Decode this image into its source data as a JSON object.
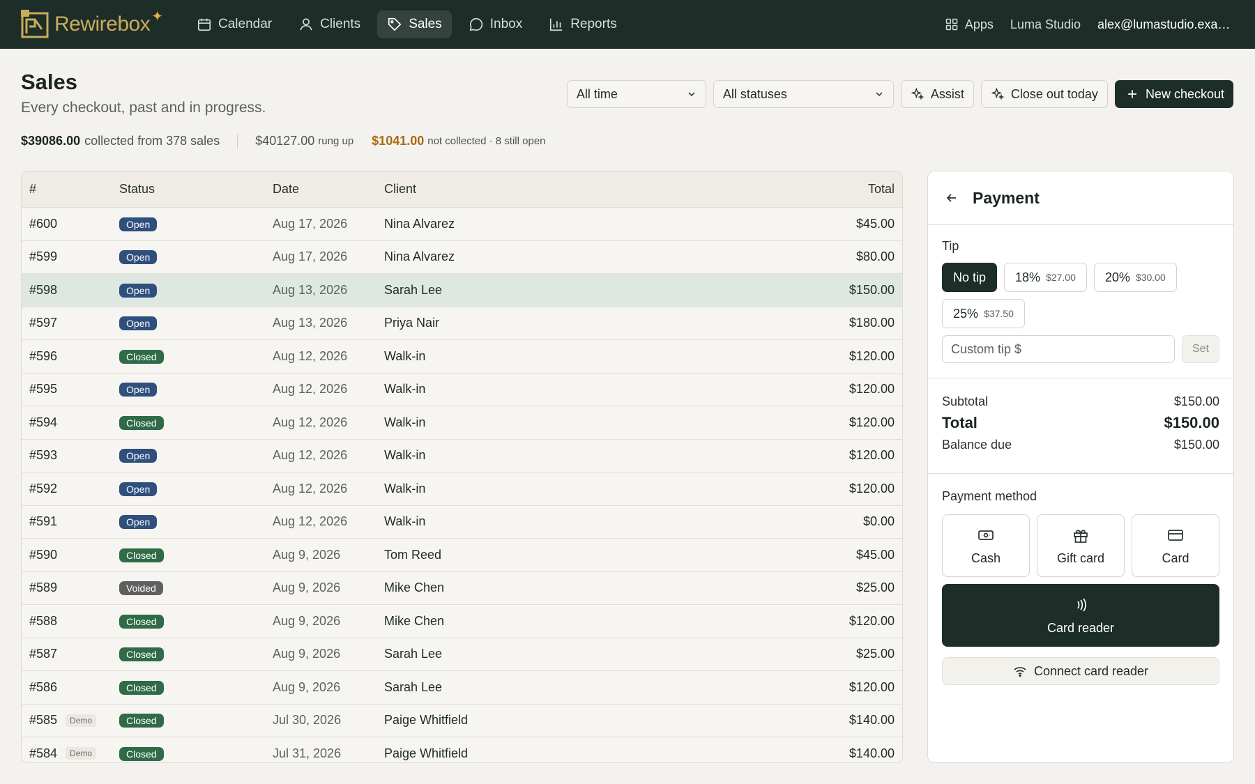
{
  "app": {
    "brand": "Rewirebox",
    "nav": [
      {
        "id": "calendar",
        "label": "Calendar",
        "icon": "calendar-icon"
      },
      {
        "id": "clients",
        "label": "Clients",
        "icon": "user-icon"
      },
      {
        "id": "sales",
        "label": "Sales",
        "icon": "tag-icon",
        "active": true
      },
      {
        "id": "inbox",
        "label": "Inbox",
        "icon": "chat-icon"
      },
      {
        "id": "reports",
        "label": "Reports",
        "icon": "bar-chart-icon"
      }
    ],
    "apps_label": "Apps",
    "workspace": "Luma Studio",
    "user_email": "alex@lumastudio.example.com"
  },
  "header": {
    "title": "Sales",
    "subtitle": "Every checkout, past and in progress.",
    "filters": {
      "time": "All time",
      "status": "All statuses"
    },
    "assist_label": "Assist",
    "close_out_label": "Close out today",
    "new_checkout_label": "New checkout"
  },
  "summary": {
    "collected_amount": "$39086.00",
    "collected_text": "collected from 378 sales",
    "rung_amount": "$40127.00",
    "rung_text": "rung up",
    "not_collected_amount": "$1041.00",
    "not_collected_text": "not collected · 8 still open"
  },
  "table": {
    "columns": [
      "#",
      "Status",
      "Date",
      "Client",
      "Total"
    ],
    "rows": [
      {
        "num": "#600",
        "status": "Open",
        "date": "Aug 17, 2026",
        "client": "Nina Alvarez",
        "total": "$45.00"
      },
      {
        "num": "#599",
        "status": "Open",
        "date": "Aug 17, 2026",
        "client": "Nina Alvarez",
        "total": "$80.00"
      },
      {
        "num": "#598",
        "status": "Open",
        "date": "Aug 13, 2026",
        "client": "Sarah Lee",
        "total": "$150.00",
        "selected": true
      },
      {
        "num": "#597",
        "status": "Open",
        "date": "Aug 13, 2026",
        "client": "Priya Nair",
        "total": "$180.00"
      },
      {
        "num": "#596",
        "status": "Closed",
        "date": "Aug 12, 2026",
        "client": "Walk-in",
        "total": "$120.00"
      },
      {
        "num": "#595",
        "status": "Open",
        "date": "Aug 12, 2026",
        "client": "Walk-in",
        "total": "$120.00"
      },
      {
        "num": "#594",
        "status": "Closed",
        "date": "Aug 12, 2026",
        "client": "Walk-in",
        "total": "$120.00"
      },
      {
        "num": "#593",
        "status": "Open",
        "date": "Aug 12, 2026",
        "client": "Walk-in",
        "total": "$120.00"
      },
      {
        "num": "#592",
        "status": "Open",
        "date": "Aug 12, 2026",
        "client": "Walk-in",
        "total": "$120.00"
      },
      {
        "num": "#591",
        "status": "Open",
        "date": "Aug 12, 2026",
        "client": "Walk-in",
        "total": "$0.00"
      },
      {
        "num": "#590",
        "status": "Closed",
        "date": "Aug 9, 2026",
        "client": "Tom Reed",
        "total": "$45.00"
      },
      {
        "num": "#589",
        "status": "Voided",
        "date": "Aug 9, 2026",
        "client": "Mike Chen",
        "total": "$25.00"
      },
      {
        "num": "#588",
        "status": "Closed",
        "date": "Aug 9, 2026",
        "client": "Mike Chen",
        "total": "$120.00"
      },
      {
        "num": "#587",
        "status": "Closed",
        "date": "Aug 9, 2026",
        "client": "Sarah Lee",
        "total": "$25.00"
      },
      {
        "num": "#586",
        "status": "Closed",
        "date": "Aug 9, 2026",
        "client": "Sarah Lee",
        "total": "$120.00"
      },
      {
        "num": "#585",
        "demo": "Demo",
        "status": "Closed",
        "date": "Jul 30, 2026",
        "client": "Paige Whitfield",
        "total": "$140.00"
      },
      {
        "num": "#584",
        "demo": "Demo",
        "status": "Closed",
        "date": "Jul 31, 2026",
        "client": "Paige Whitfield",
        "total": "$140.00"
      }
    ]
  },
  "payment": {
    "title": "Payment",
    "tip_label": "Tip",
    "tips": [
      {
        "label": "No tip",
        "amount": "",
        "active": true
      },
      {
        "label": "18%",
        "amount": "$27.00"
      },
      {
        "label": "20%",
        "amount": "$30.00"
      },
      {
        "label": "25%",
        "amount": "$37.50"
      }
    ],
    "custom_tip_placeholder": "Custom tip $",
    "set_label": "Set",
    "subtotal_label": "Subtotal",
    "subtotal": "$150.00",
    "total_label": "Total",
    "total": "$150.00",
    "balance_label": "Balance due",
    "balance": "$150.00",
    "method_label": "Payment method",
    "methods": [
      {
        "label": "Cash",
        "icon": "cash-icon"
      },
      {
        "label": "Gift card",
        "icon": "gift-icon"
      },
      {
        "label": "Card",
        "icon": "credit-card-icon"
      }
    ],
    "card_reader_label": "Card reader",
    "connect_label": "Connect card reader"
  },
  "colors": {
    "nav_bg": "#1d2d28",
    "brand_gold": "#c9ad5c",
    "open_badge": "#2f4f7d",
    "closed_badge": "#2f6b47",
    "voided_badge": "#5f5f5f",
    "warning": "#a86a12"
  }
}
